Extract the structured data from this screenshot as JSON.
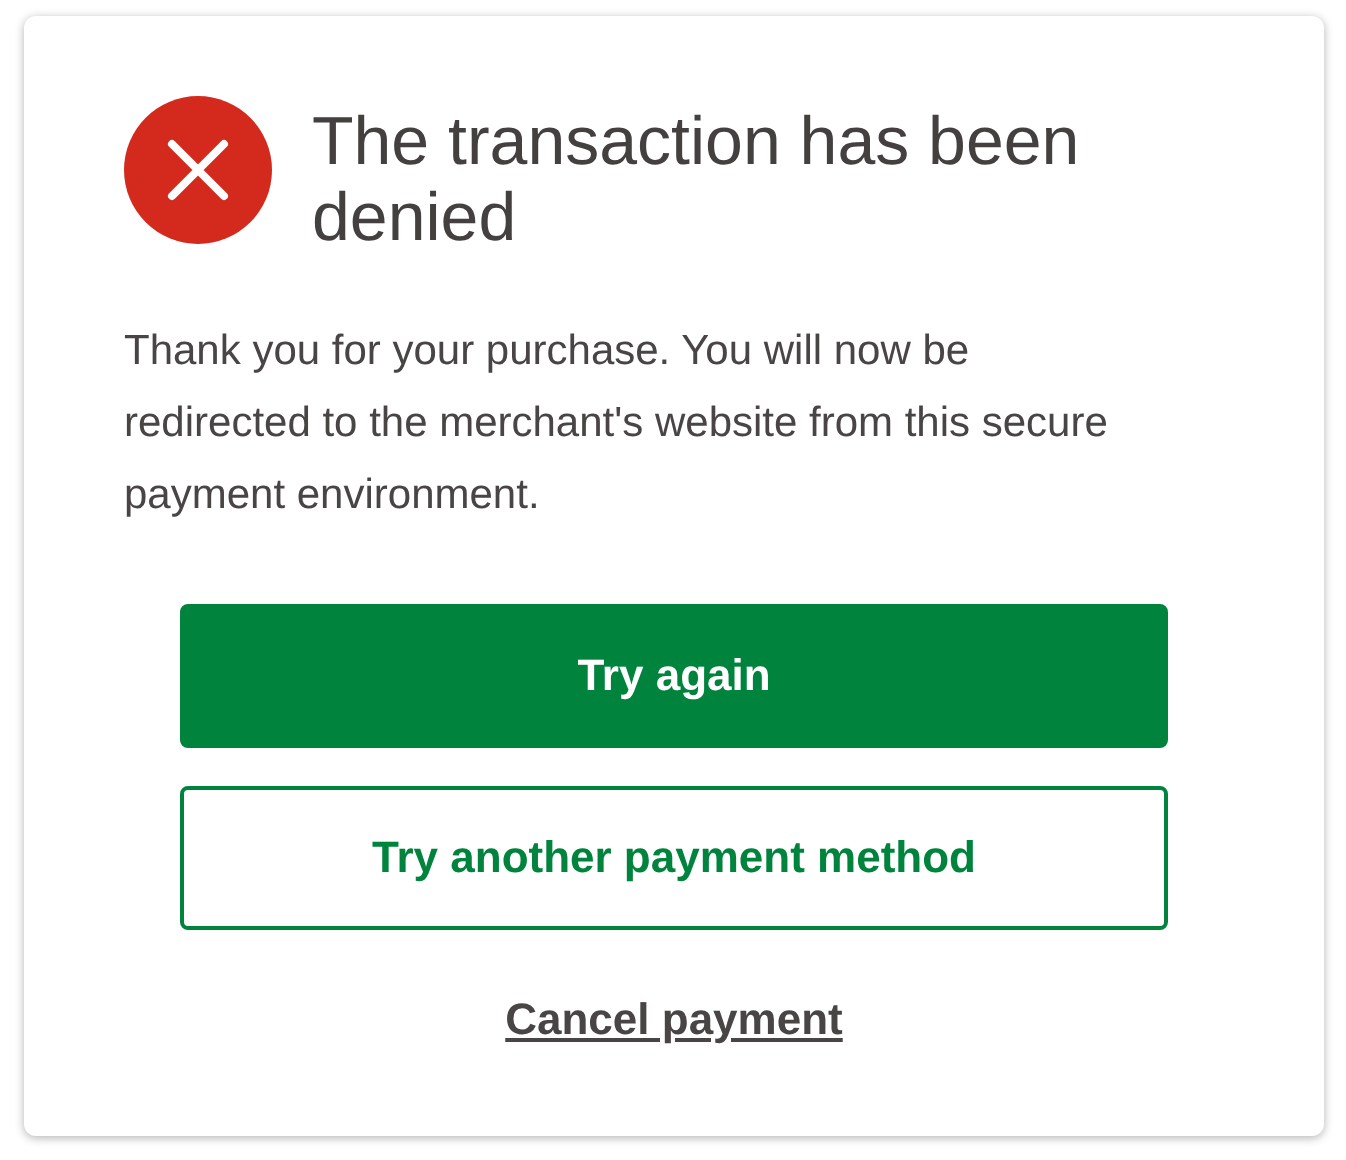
{
  "dialog": {
    "error": true,
    "title": "The transaction has been denied",
    "message": "Thank you for your purchase. You will now be redirected to the merchant's website from this secure payment environment.",
    "actions": [
      {
        "kind": "primary",
        "label": "Try again"
      },
      {
        "kind": "outline",
        "label": "Try another payment method"
      },
      {
        "kind": "link",
        "label": "Cancel payment"
      }
    ]
  }
}
